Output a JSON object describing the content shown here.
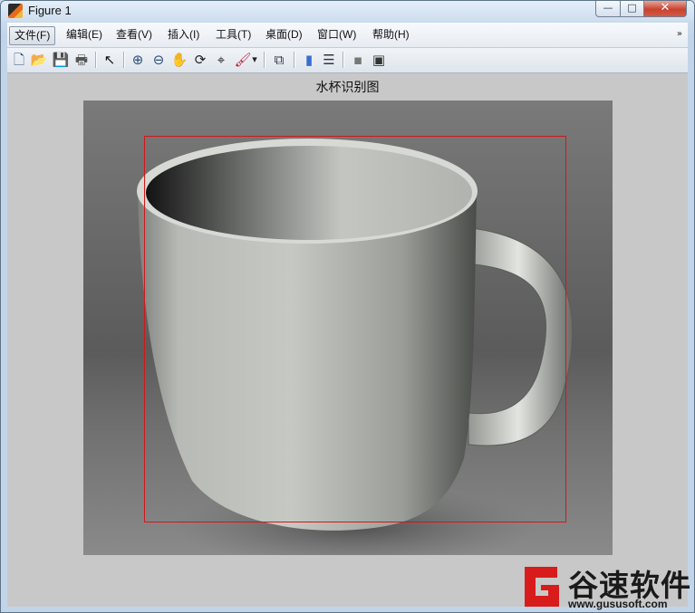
{
  "window": {
    "title": "Figure 1",
    "buttons": {
      "minimize": "—",
      "maximize": "□",
      "close": "✕"
    }
  },
  "menubar": {
    "items": [
      {
        "label": "文件(F)"
      },
      {
        "label": "编辑(E)"
      },
      {
        "label": "查看(V)"
      },
      {
        "label": "插入(I)"
      },
      {
        "label": "工具(T)"
      },
      {
        "label": "桌面(D)"
      },
      {
        "label": "窗口(W)"
      },
      {
        "label": "帮助(H)"
      }
    ],
    "overflow": "»"
  },
  "toolbar": {
    "icons": [
      "new-figure-icon",
      "open-file-icon",
      "save-icon",
      "print-icon",
      "edit-plot-arrow-icon",
      "zoom-in-icon",
      "zoom-out-icon",
      "pan-hand-icon",
      "rotate-3d-icon",
      "data-cursor-icon",
      "brush-icon",
      "brush-dropdown-icon",
      "link-plot-icon",
      "insert-colorbar-icon",
      "insert-legend-icon",
      "hide-plot-tools-icon",
      "show-plot-tools-icon"
    ],
    "glyphs": {
      "new": "🗋",
      "open": "📂",
      "save": "💾",
      "print": "🖶",
      "pointer": "↖",
      "zoom_in": "⊕",
      "zoom_out": "⊖",
      "pan": "✋",
      "rotate": "⟳",
      "cursor": "⌖",
      "brush": "🖌",
      "dropdown": "▾",
      "link": "⧉",
      "colorbar": "▮",
      "legend": "☰",
      "hide": "▪",
      "show": "▣"
    }
  },
  "figure": {
    "axes_title": "水杯识别图",
    "image_subject": "gray ceramic mug",
    "bounding_box_color": "#d01818"
  },
  "watermark": {
    "brand": "谷速软件",
    "url": "www.gususoft.com",
    "logo_color": "#d81c1c"
  }
}
